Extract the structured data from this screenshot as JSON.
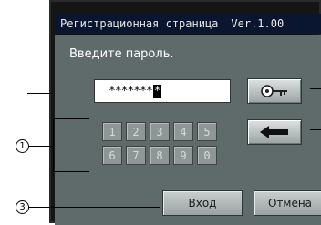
{
  "window": {
    "title": "Регистрационная страница",
    "version": "Ver.1.00"
  },
  "prompt": "Введите пароль.",
  "password_field": {
    "masked_value": "*******",
    "caret": "*"
  },
  "keypad": {
    "keys": [
      "1",
      "2",
      "3",
      "4",
      "5",
      "6",
      "7",
      "8",
      "9",
      "0"
    ]
  },
  "icons": {
    "key": "key-icon",
    "backspace": "left-arrow-icon"
  },
  "buttons": {
    "login": "Вход",
    "cancel": "Отмена"
  },
  "callouts": {
    "keypad": "1",
    "buttons": "3"
  }
}
